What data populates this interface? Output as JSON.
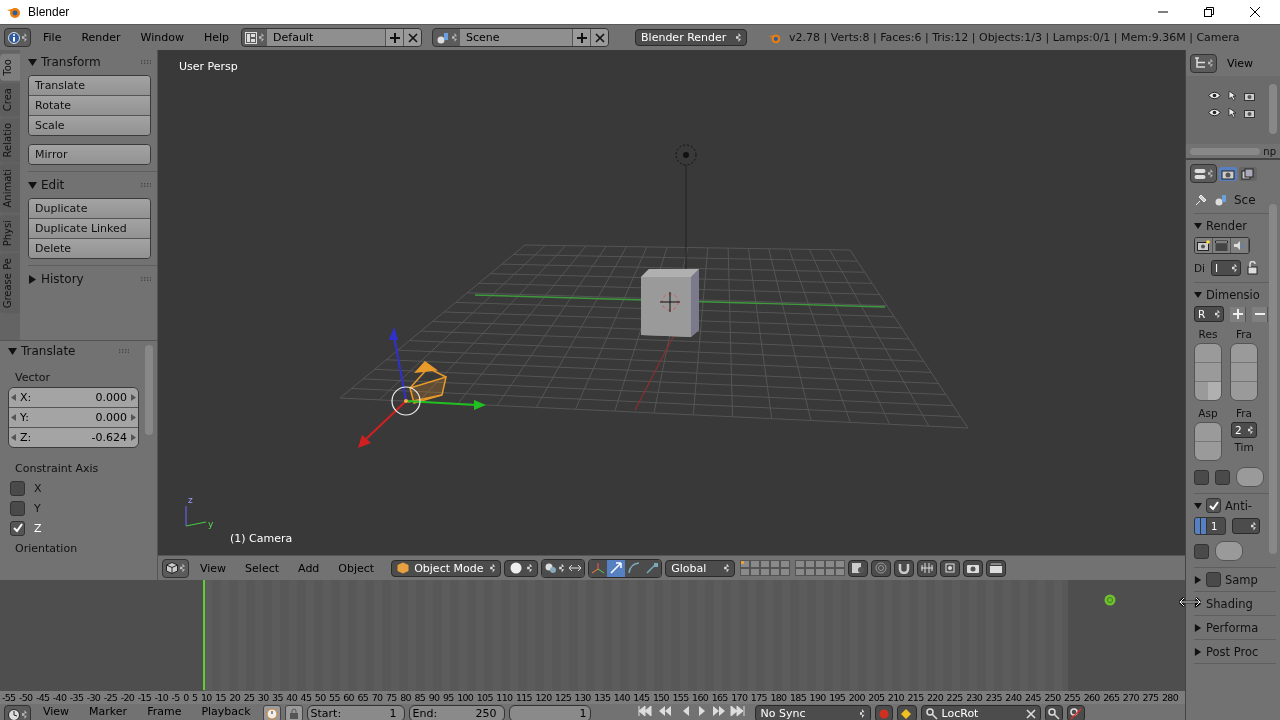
{
  "window": {
    "title": "Blender"
  },
  "info_header": {
    "menus": [
      "File",
      "Render",
      "Window",
      "Help"
    ],
    "layout": "Default",
    "scene": "Scene",
    "engine": "Blender Render",
    "stats": "v2.78 | Verts:8 | Faces:6 | Tris:12 | Objects:1/3 | Lamps:0/1 | Mem:9.36M | Camera"
  },
  "tool_shelf": {
    "tabs": [
      {
        "label": "Too",
        "selected": true
      },
      {
        "label": "Crea",
        "selected": false
      },
      {
        "label": "Relatio",
        "selected": false
      },
      {
        "label": "Animati",
        "selected": false
      },
      {
        "label": "Physi",
        "selected": false
      },
      {
        "label": "Grease Pe",
        "selected": false
      }
    ],
    "panels": [
      {
        "title": "Transform",
        "expanded": true,
        "groups": [
          [
            "Translate",
            "Rotate",
            "Scale"
          ],
          [
            "Mirror"
          ]
        ]
      },
      {
        "title": "Edit",
        "expanded": true,
        "groups": [
          [
            "Duplicate",
            "Duplicate Linked",
            "Delete"
          ]
        ]
      },
      {
        "title": "History",
        "expanded": false
      }
    ]
  },
  "operator_panel": {
    "title": "Translate",
    "expanded": true,
    "vector_label": "Vector",
    "vector": [
      {
        "axis": "X:",
        "value": "0.000"
      },
      {
        "axis": "Y:",
        "value": "0.000"
      },
      {
        "axis": "Z:",
        "value": "-0.624"
      }
    ],
    "constraint_label": "Constraint Axis",
    "constraints": [
      {
        "label": "X",
        "checked": false
      },
      {
        "label": "Y",
        "checked": false
      },
      {
        "label": "Z",
        "checked": true
      }
    ],
    "next_label": "Orientation"
  },
  "viewport": {
    "view_label": "User Persp",
    "object_label": "(1) Camera",
    "axis_labels": [
      "z",
      "y"
    ]
  },
  "view3d_header": {
    "menus": [
      "View",
      "Select",
      "Add",
      "Object"
    ],
    "mode": "Object Mode",
    "orientation": "Global"
  },
  "outliner": {
    "view_menu": "View",
    "rows": [
      {
        "visible": true
      },
      {
        "visible": true
      }
    ],
    "cut_label": "np"
  },
  "properties": {
    "context": "Sce",
    "panels": [
      {
        "kind": "render",
        "title": "Render",
        "expanded": true,
        "display_label": "Di",
        "display_value": "I"
      },
      {
        "kind": "dimensions",
        "title": "Dimensio",
        "expanded": true,
        "preset": "R",
        "resolution_label": "Res",
        "frame_range_label": "Fra",
        "aspect_label": "Asp",
        "frame_rate_label": "Fra",
        "frame_rate": "2",
        "time_label": "Tim",
        "toggles": [
          {
            "on": false
          },
          {
            "on": false
          }
        ]
      },
      {
        "kind": "antialias",
        "title": "Anti-",
        "expanded": true,
        "checked": true,
        "samples": "1",
        "full_sample": false
      },
      {
        "kind": "toggle",
        "title": "Samp",
        "expanded": false,
        "checked": false
      },
      {
        "kind": "plain",
        "title": "Shading",
        "expanded": false
      },
      {
        "kind": "plain",
        "title": "Performa",
        "expanded": false
      },
      {
        "kind": "plain",
        "title": "Post Proc",
        "expanded": false
      }
    ]
  },
  "timeline": {
    "ruler": [
      "-55",
      "-50",
      "-45",
      "-40",
      "-35",
      "-30",
      "-25",
      "-20",
      "-15",
      "-10",
      "-5",
      "0",
      "5",
      "10",
      "15",
      "20",
      "25",
      "30",
      "35",
      "40",
      "45",
      "50",
      "55",
      "60",
      "65",
      "70",
      "75",
      "80",
      "85",
      "90",
      "95",
      "100",
      "105",
      "110",
      "115",
      "120",
      "125",
      "130",
      "135",
      "140",
      "145",
      "150",
      "155",
      "160",
      "165",
      "170",
      "175",
      "180",
      "185",
      "190",
      "195",
      "200",
      "205",
      "210",
      "215",
      "220",
      "225",
      "230",
      "235",
      "240",
      "245",
      "250",
      "255",
      "260",
      "265",
      "270",
      "275",
      "280"
    ],
    "menus": [
      "View",
      "Marker",
      "Frame",
      "Playback"
    ],
    "start_label": "Start:",
    "start": "1",
    "end_label": "End:",
    "end": "250",
    "current": "1",
    "sync": "No Sync",
    "keying_set": "LocRot"
  }
}
